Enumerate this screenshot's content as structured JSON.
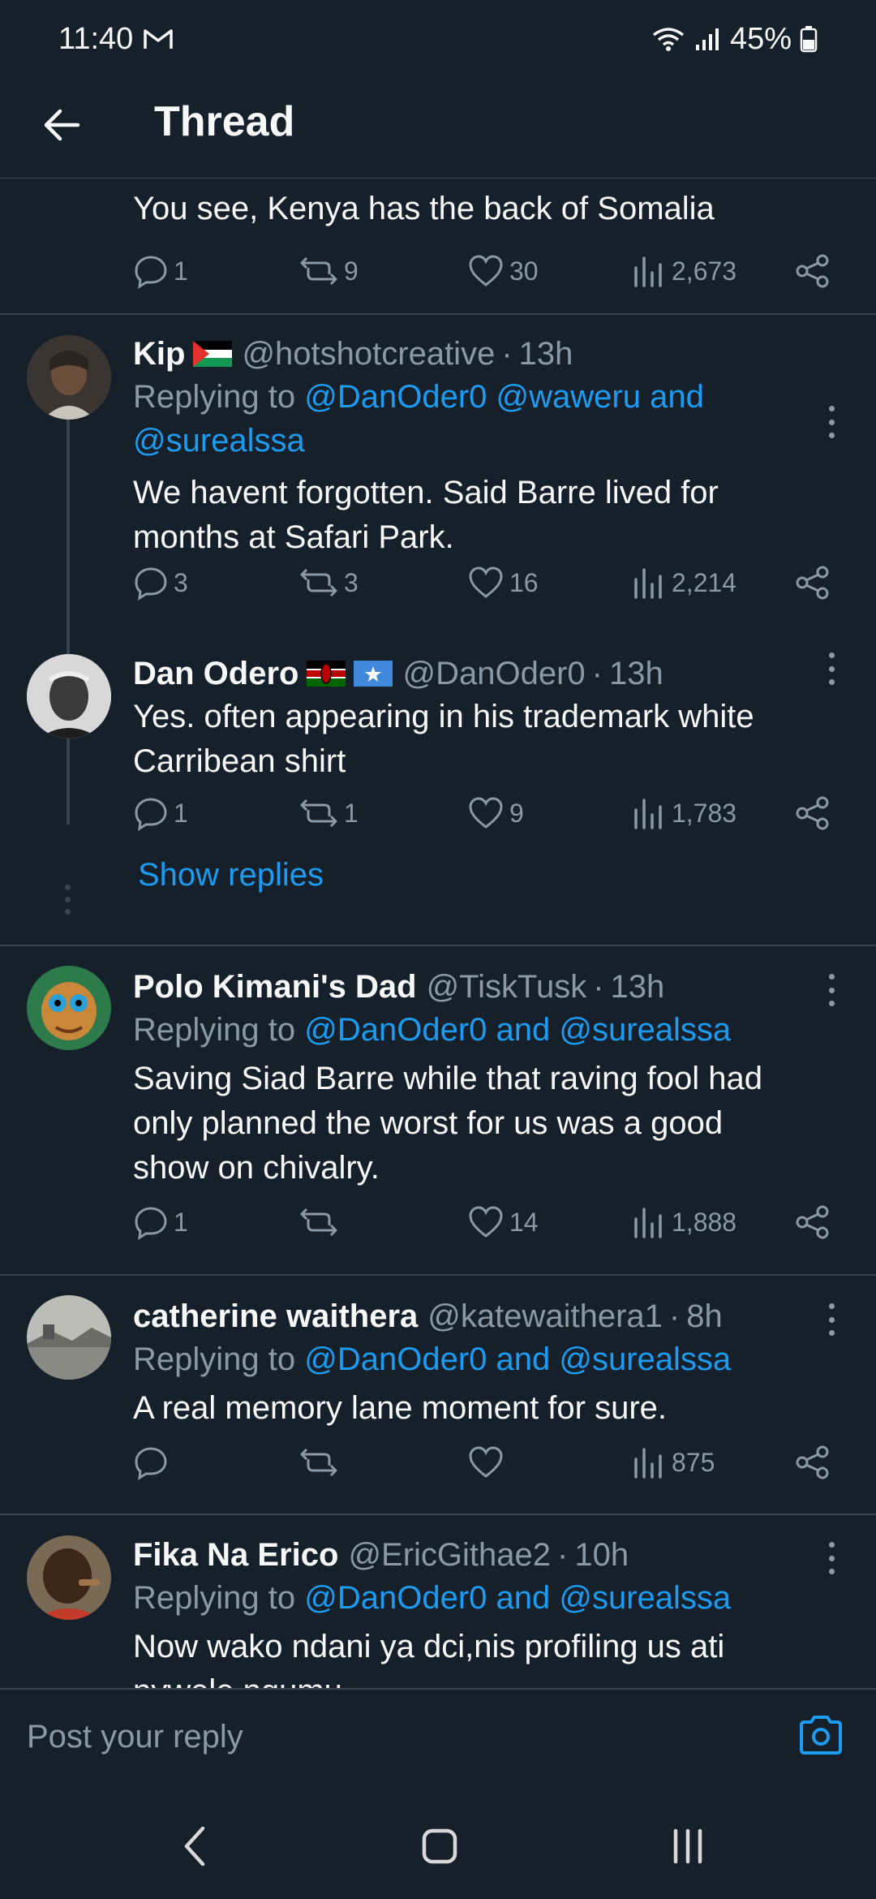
{
  "status_bar": {
    "time": "11:40",
    "battery": "45%"
  },
  "header": {
    "title": "Thread"
  },
  "colors": {
    "background": "#15202b",
    "link": "#1d9bf0",
    "muted": "#8b98a5",
    "divider": "#38444d"
  },
  "tweets": [
    {
      "text": "You see, Kenya has the back of Somalia",
      "replies": "1",
      "reposts": "9",
      "likes": "30",
      "views": "2,673"
    },
    {
      "display_name": "Kip",
      "flags": [
        "palestine-flag"
      ],
      "handle": "@hotshotcreative",
      "time": "13h",
      "replying_prefix": "Replying to",
      "replying_to": "@DanOder0 @waweru and",
      "replying_to_line2": "@surealssa",
      "text_lines": [
        "We havent forgotten. Said Barre lived for",
        "months at Safari Park."
      ],
      "replies": "3",
      "reposts": "3",
      "likes": "16",
      "views": "2,214"
    },
    {
      "display_name": "Dan Odero",
      "flags": [
        "kenya-flag",
        "somalia-flag"
      ],
      "handle": "@DanOder0",
      "time": "13h",
      "text_lines": [
        "Yes. often appearing in his trademark white",
        "Carribean shirt"
      ],
      "replies": "1",
      "reposts": "1",
      "likes": "9",
      "views": "1,783",
      "show_replies": "Show replies"
    },
    {
      "display_name": "Polo Kimani's Dad",
      "handle": "@TiskTusk",
      "time": "13h",
      "replying_prefix": "Replying to",
      "replying_to": "@DanOder0 and @surealssa",
      "text_lines": [
        "Saving Siad Barre while that raving fool had",
        "only planned the worst for us was a good",
        "show on chivalry."
      ],
      "replies": "1",
      "reposts": "",
      "likes": "14",
      "views": "1,888"
    },
    {
      "display_name": "catherine waithera",
      "handle": "@katewaithera1",
      "time": "8h",
      "replying_prefix": "Replying to",
      "replying_to": "@DanOder0 and @surealssa",
      "text_lines": [
        "A real memory lane moment for sure."
      ],
      "replies": "",
      "reposts": "",
      "likes": "",
      "views": "875"
    },
    {
      "display_name": "Fika Na Erico",
      "handle": "@EricGithae2",
      "time": "10h",
      "replying_prefix": "Replying to",
      "replying_to": "@DanOder0 and @surealssa",
      "text_lines": [
        "Now wako ndani ya dci,nis profiling us ati",
        "nywele ngumu"
      ]
    }
  ],
  "composer": {
    "placeholder": "Post your reply"
  },
  "nav": {
    "icons": [
      "back-nav-icon",
      "home-nav-icon",
      "recents-nav-icon"
    ]
  }
}
